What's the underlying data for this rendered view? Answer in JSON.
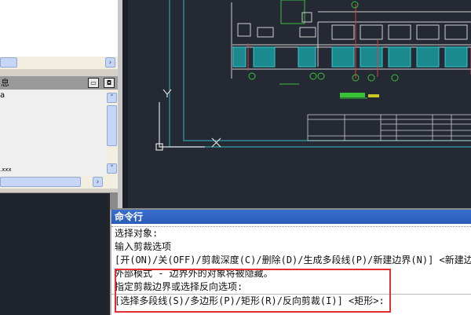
{
  "left_panel": {
    "header_fragment": "息",
    "list_fragment": "a",
    "file_fragment": ".xxx"
  },
  "icons": {
    "scroll_right": "›",
    "scroll_up": "˄",
    "scroll_down": "˅"
  },
  "command_window": {
    "title": "命令行",
    "lines": [
      "选择对象:",
      "输入剪裁选项",
      "[开(ON)/关(OFF)/剪裁深度(C)/删除(D)/生成多段线(P)/新建边界(N)] <新建边界>:",
      "外部模式 - 边界外的对象将被隐藏。",
      "指定剪裁边界或选择反向选项:",
      "[选择多段线(S)/多边形(P)/矩形(R)/反向剪裁(I)] <矩形>:"
    ]
  },
  "colors": {
    "highlight": "#e03030",
    "title_bar": "#2a5bb8",
    "canvas": "#252934"
  }
}
